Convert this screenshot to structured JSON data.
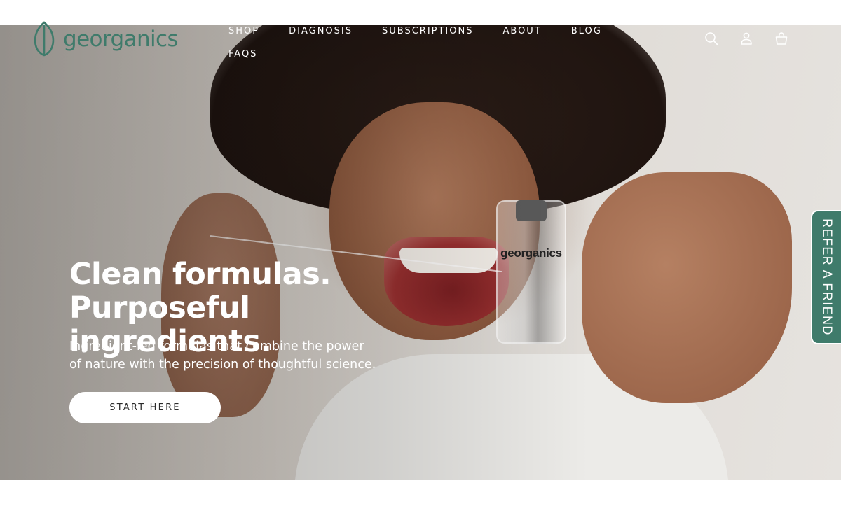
{
  "brand": {
    "name": "georganics",
    "accent": "#3f7b6b"
  },
  "nav": {
    "items": [
      "SHOP",
      "DIAGNOSIS",
      "SUBSCRIPTIONS",
      "ABOUT",
      "BLOG"
    ],
    "faqs": "FAQS"
  },
  "header_icons": [
    "search-icon",
    "account-icon",
    "cart-icon"
  ],
  "hero": {
    "title_line1": "Clean formulas.",
    "title_line2": "Purposeful ingredients.",
    "subtitle_line1": "Ingredient-led formulas that combine the power",
    "subtitle_line2": "of nature with the precision of thoughtful science.",
    "cta_label": "START HERE",
    "jar_label": "georganics"
  },
  "refer_tab": {
    "label": "REFER A FRIEND"
  }
}
